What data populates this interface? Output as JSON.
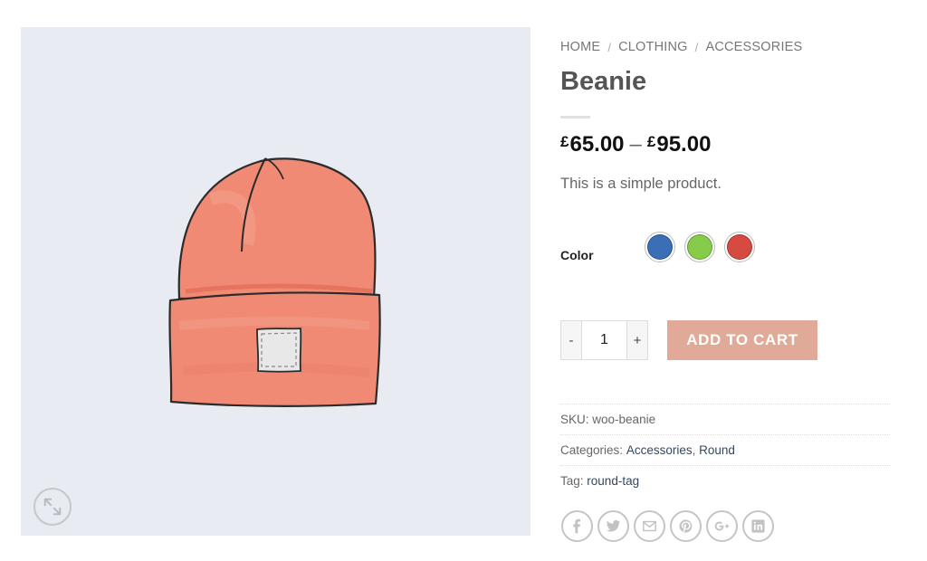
{
  "breadcrumb": {
    "home": "HOME",
    "clothing": "CLOTHING",
    "accessories": "ACCESSORIES",
    "separator": "/"
  },
  "product": {
    "title": "Beanie",
    "price_currency": "£",
    "price_min": "65.00",
    "price_separator": "–",
    "price_max": "95.00",
    "description": "This is a simple product."
  },
  "variations": {
    "color_label": "Color",
    "swatches": [
      {
        "name": "blue",
        "color": "#3a6fb6"
      },
      {
        "name": "green",
        "color": "#86cc4a"
      },
      {
        "name": "red",
        "color": "#d64a40"
      }
    ]
  },
  "cart": {
    "minus_label": "-",
    "quantity": "1",
    "plus_label": "+",
    "add_label": "ADD TO CART"
  },
  "meta": {
    "sku_label": "SKU:",
    "sku_value": "woo-beanie",
    "categories_label": "Categories:",
    "category_1": "Accessories",
    "category_sep": ",",
    "category_2": "Round",
    "tag_label": "Tag:",
    "tag_value": "round-tag"
  },
  "share": [
    "facebook-icon",
    "twitter-icon",
    "email-icon",
    "pinterest-icon",
    "google-plus-icon",
    "linkedin-icon"
  ],
  "colors": {
    "accent_button": "#e0a998",
    "gallery_bg": "#e8ecf2",
    "beanie": "#f08a74",
    "link": "#334862"
  }
}
